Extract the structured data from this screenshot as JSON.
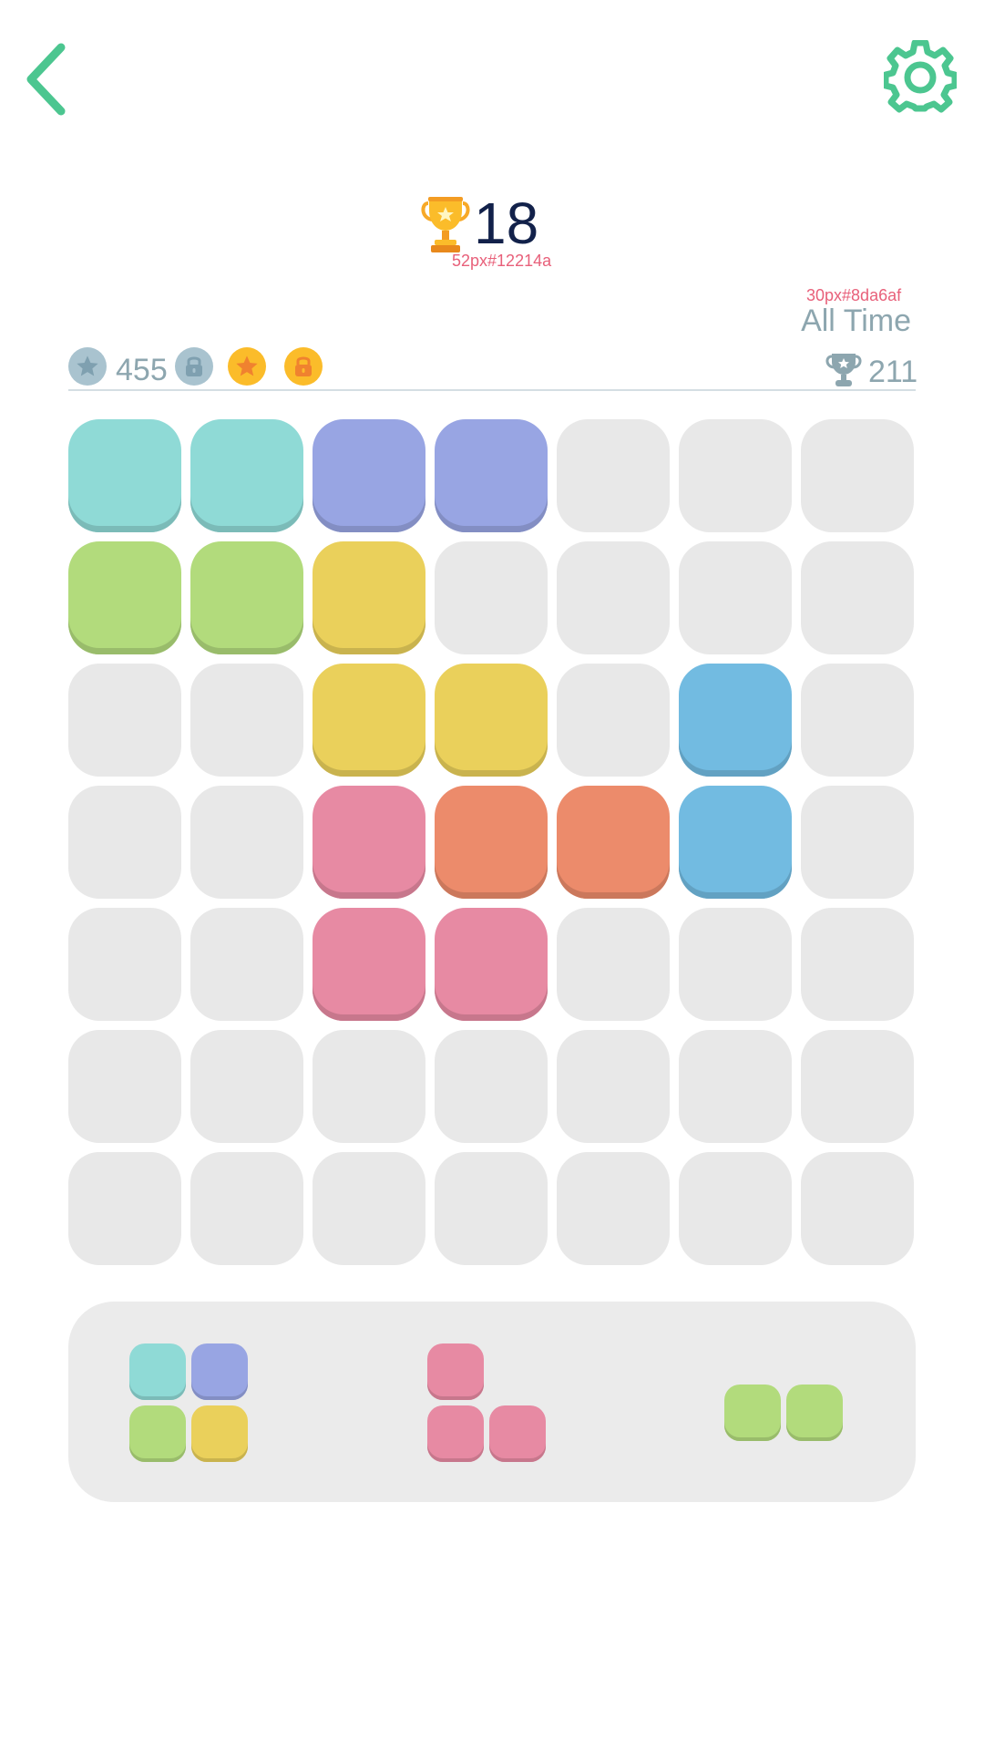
{
  "header": {
    "back_icon": "chevron-left-icon",
    "settings_icon": "gear-icon",
    "accent_color": "#4cc690"
  },
  "score": {
    "value": "18",
    "annotation": "52px#12214a",
    "trophy_icon": "trophy-icon",
    "color": "#12214a"
  },
  "all_time": {
    "annotation": "30px#8da6af",
    "label": "All Time",
    "color": "#8da6af"
  },
  "stats": {
    "stars_icon": "star-icon",
    "stars_count": "455",
    "lock_icon": "lock-icon",
    "gold_star_icon": "star-icon",
    "gold_lock_icon": "lock-icon",
    "best_trophy_icon": "trophy-icon",
    "best_count": "211",
    "gray_color": "#a9c3cf",
    "gold_color": "#fbbc2a"
  },
  "colors": {
    "teal": "#8fdad6",
    "purple": "#98a5e3",
    "green": "#b2db7c",
    "yellow": "#ead05b",
    "blue": "#72bbe1",
    "pink": "#e78aa3",
    "orange": "#ec8b6b",
    "empty": "#e8e8e8"
  },
  "board": {
    "rows": 7,
    "cols": 7,
    "cells": [
      [
        "teal",
        "teal",
        "purple",
        "purple",
        "",
        "",
        ""
      ],
      [
        "green",
        "green",
        "yellow",
        "",
        "",
        "",
        ""
      ],
      [
        "",
        "",
        "yellow",
        "yellow",
        "",
        "blue",
        ""
      ],
      [
        "",
        "",
        "pink",
        "orange",
        "orange",
        "blue",
        ""
      ],
      [
        "",
        "",
        "pink",
        "pink",
        "",
        "",
        ""
      ],
      [
        "",
        "",
        "",
        "",
        "",
        "",
        ""
      ],
      [
        "",
        "",
        "",
        "",
        "",
        "",
        ""
      ]
    ]
  },
  "tray": {
    "pieces": [
      {
        "name": "piece-square-multicolor",
        "blocks": [
          [
            0,
            0,
            "teal"
          ],
          [
            1,
            0,
            "purple"
          ],
          [
            0,
            1,
            "green"
          ],
          [
            1,
            1,
            "yellow"
          ]
        ]
      },
      {
        "name": "piece-l-pink",
        "blocks": [
          [
            0,
            0,
            "pink"
          ],
          [
            0,
            1,
            "pink"
          ],
          [
            1,
            1,
            "pink"
          ]
        ]
      },
      {
        "name": "piece-domino-green",
        "blocks": [
          [
            0,
            0,
            "green"
          ],
          [
            1,
            0,
            "green"
          ]
        ]
      }
    ]
  }
}
